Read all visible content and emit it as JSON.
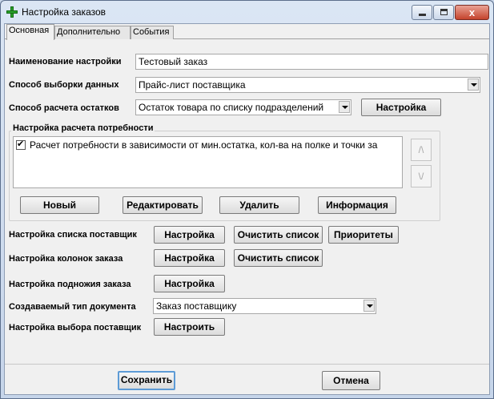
{
  "window": {
    "title": "Настройка заказов",
    "close_glyph": "x"
  },
  "tabs": [
    {
      "label": "Основная",
      "active": true
    },
    {
      "label": "Дополнительно",
      "active": false
    },
    {
      "label": "События",
      "active": false
    }
  ],
  "form": {
    "name_label": "Наименование настройки",
    "name_value": "Тестовый заказ",
    "sampling_label": "Способ выборки данных",
    "sampling_value": "Прайс-лист поставщика",
    "stock_label": "Способ расчета остатков",
    "stock_value": "Остаток товара по списку подразделений",
    "stock_setup_button": "Настройка"
  },
  "demand_group": {
    "title": "Настройка расчета потребности",
    "items": [
      {
        "checked": true,
        "text": "Расчет потребности в зависимости от мин.остатка, кол-ва на полке и точки за"
      }
    ],
    "up_glyph": "/\\",
    "down_glyph": "\\/",
    "buttons": {
      "new": "Новый",
      "edit": "Редактировать",
      "delete": "Удалить",
      "info": "Информация"
    }
  },
  "settings": {
    "supplier_list_label": "Настройка списка поставщик",
    "supplier_list_setup": "Настройка",
    "supplier_list_clear": "Очистить список",
    "supplier_list_priorities": "Приоритеты",
    "columns_label": "Настройка колонок заказа",
    "columns_setup": "Настройка",
    "columns_clear": "Очистить список",
    "footer_label": "Настройка подножия заказа",
    "footer_setup": "Настройка",
    "doc_type_label": "Создаваемый тип документа",
    "doc_type_value": "Заказ поставщику",
    "supplier_select_label": "Настройка выбора поставщик",
    "supplier_select_button": "Настроить"
  },
  "actions": {
    "save": "Сохранить",
    "cancel": "Отмена"
  },
  "colors": {
    "accent": "#5d9bd6",
    "close": "#c5432c",
    "icon": "#2aa02a"
  }
}
